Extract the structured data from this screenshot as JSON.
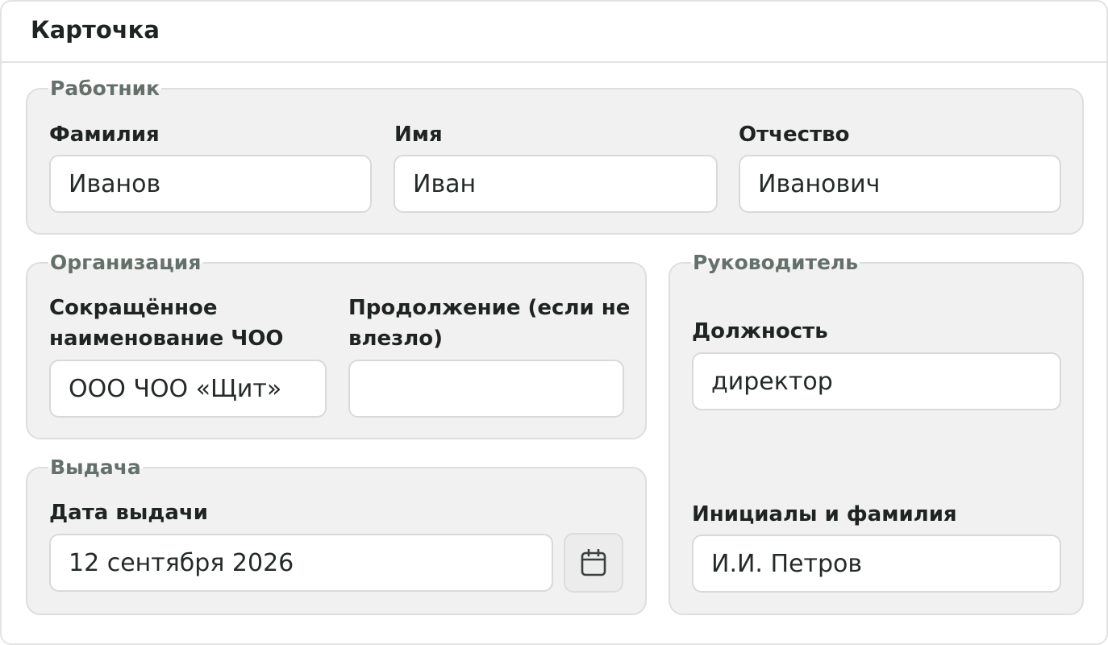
{
  "card": {
    "title": "Карточка"
  },
  "employee": {
    "legend": "Работник",
    "last_name_label": "Фамилия",
    "last_name_value": "Иванов",
    "first_name_label": "Имя",
    "first_name_value": "Иван",
    "patronymic_label": "Отчество",
    "patronymic_value": "Иванович"
  },
  "organization": {
    "legend": "Организация",
    "short_name_label_line1": "Сокращённое",
    "short_name_label_line2": "наименование ЧОО",
    "short_name_value": "ООО ЧОО «Щит»",
    "continuation_label_line1": "Продолжение (если не",
    "continuation_label_line2": "влезло)",
    "continuation_value": ""
  },
  "issue": {
    "legend": "Выдача",
    "date_label": "Дата выдачи",
    "date_value": "12 сентября 2026",
    "calendar_icon": "calendar-icon"
  },
  "manager": {
    "legend": "Руководитель",
    "position_label": "Должность",
    "position_value": "директор",
    "name_label": "Инициалы и фамилия",
    "name_value": "И.И. Петров"
  }
}
